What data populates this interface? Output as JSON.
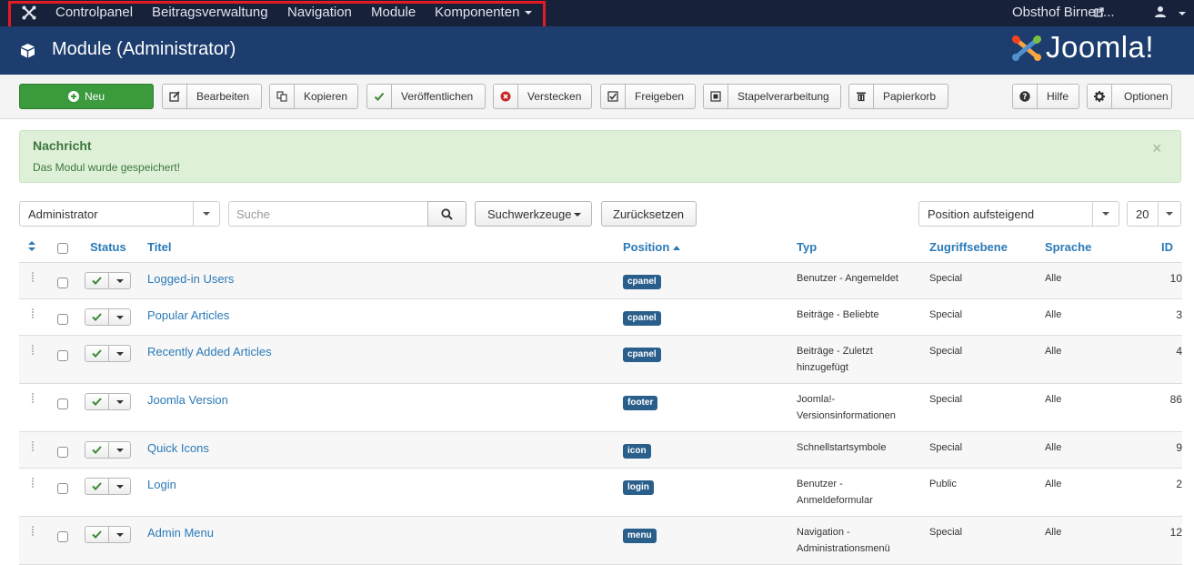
{
  "navbar": {
    "items": [
      "Controlpanel",
      "Beitragsverwaltung",
      "Navigation",
      "Module",
      "Komponenten"
    ],
    "site_name": "Obsthof Birnen..."
  },
  "header": {
    "title": "Module (Administrator)",
    "brand": "Joomla!"
  },
  "toolbar": {
    "new": "Neu",
    "edit": "Bearbeiten",
    "copy": "Kopieren",
    "publish": "Veröffentlichen",
    "unpublish": "Verstecken",
    "checkin": "Freigeben",
    "batch": "Stapelverarbeitung",
    "trash": "Papierkorb",
    "help": "Hilfe",
    "options": "Optionen"
  },
  "alert": {
    "heading": "Nachricht",
    "text": "Das Modul wurde gespeichert!",
    "close": "×"
  },
  "filters": {
    "client": "Administrator",
    "search_placeholder": "Suche",
    "search_tools": "Suchwerkzeuge",
    "reset": "Zurücksetzen",
    "ordering": "Position aufsteigend",
    "limit": "20"
  },
  "table": {
    "headers": {
      "status": "Status",
      "title": "Titel",
      "position": "Position",
      "type": "Typ",
      "access": "Zugriffsebene",
      "language": "Sprache",
      "id": "ID"
    },
    "rows": [
      {
        "title": "Logged-in Users",
        "position": "cpanel",
        "type": "Benutzer - Angemeldet",
        "access": "Special",
        "language": "Alle",
        "id": "10"
      },
      {
        "title": "Popular Articles",
        "position": "cpanel",
        "type": "Beiträge - Beliebte",
        "access": "Special",
        "language": "Alle",
        "id": "3"
      },
      {
        "title": "Recently Added Articles",
        "position": "cpanel",
        "type": "Beiträge - Zuletzt hinzugefügt",
        "type_line1": "Beiträge - Zuletzt",
        "type_line2": "hinzugefügt",
        "access": "Special",
        "language": "Alle",
        "id": "4"
      },
      {
        "title": "Joomla Version",
        "position": "footer",
        "type": "Joomla!- Versionsinformationen",
        "type_line1": "Joomla!-",
        "type_line2": "Versionsinformationen",
        "access": "Special",
        "language": "Alle",
        "id": "86"
      },
      {
        "title": "Quick Icons",
        "position": "icon",
        "type": "Schnellstartsymbole",
        "access": "Special",
        "language": "Alle",
        "id": "9"
      },
      {
        "title": "Login",
        "position": "login",
        "type": "Benutzer - Anmeldeformular",
        "type_line1": "Benutzer -",
        "type_line2": "Anmeldeformular",
        "access": "Public",
        "language": "Alle",
        "id": "2"
      },
      {
        "title": "Admin Menu",
        "position": "menu",
        "type": "Navigation - Administrationsmenü",
        "type_line1": "Navigation -",
        "type_line2": "Administrationsmenü",
        "access": "Special",
        "language": "Alle",
        "id": "12"
      }
    ]
  }
}
